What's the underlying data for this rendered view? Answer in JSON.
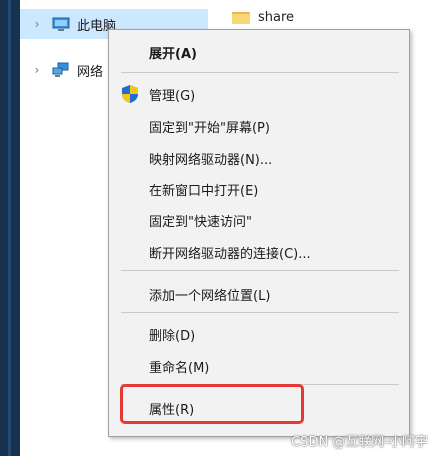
{
  "nav": {
    "items": [
      {
        "label": "此电脑",
        "icon": "computer-icon",
        "selected": true
      },
      {
        "label": "网络",
        "icon": "network-icon",
        "selected": false
      }
    ]
  },
  "files": [
    {
      "name": "share",
      "icon": "folder-icon"
    }
  ],
  "menu": {
    "expand": "展开(A)",
    "manage": "管理(G)",
    "pin_start": "固定到\"开始\"屏幕(P)",
    "map_drive": "映射网络驱动器(N)...",
    "open_new_window": "在新窗口中打开(E)",
    "pin_quick": "固定到\"快速访问\"",
    "disconnect_drive": "断开网络驱动器的连接(C)...",
    "add_network_location": "添加一个网络位置(L)",
    "delete": "删除(D)",
    "rename": "重命名(M)",
    "properties": "属性(R)"
  },
  "highlight_color": "#e53935",
  "watermark": "CSDN @互联网-小阿宇"
}
